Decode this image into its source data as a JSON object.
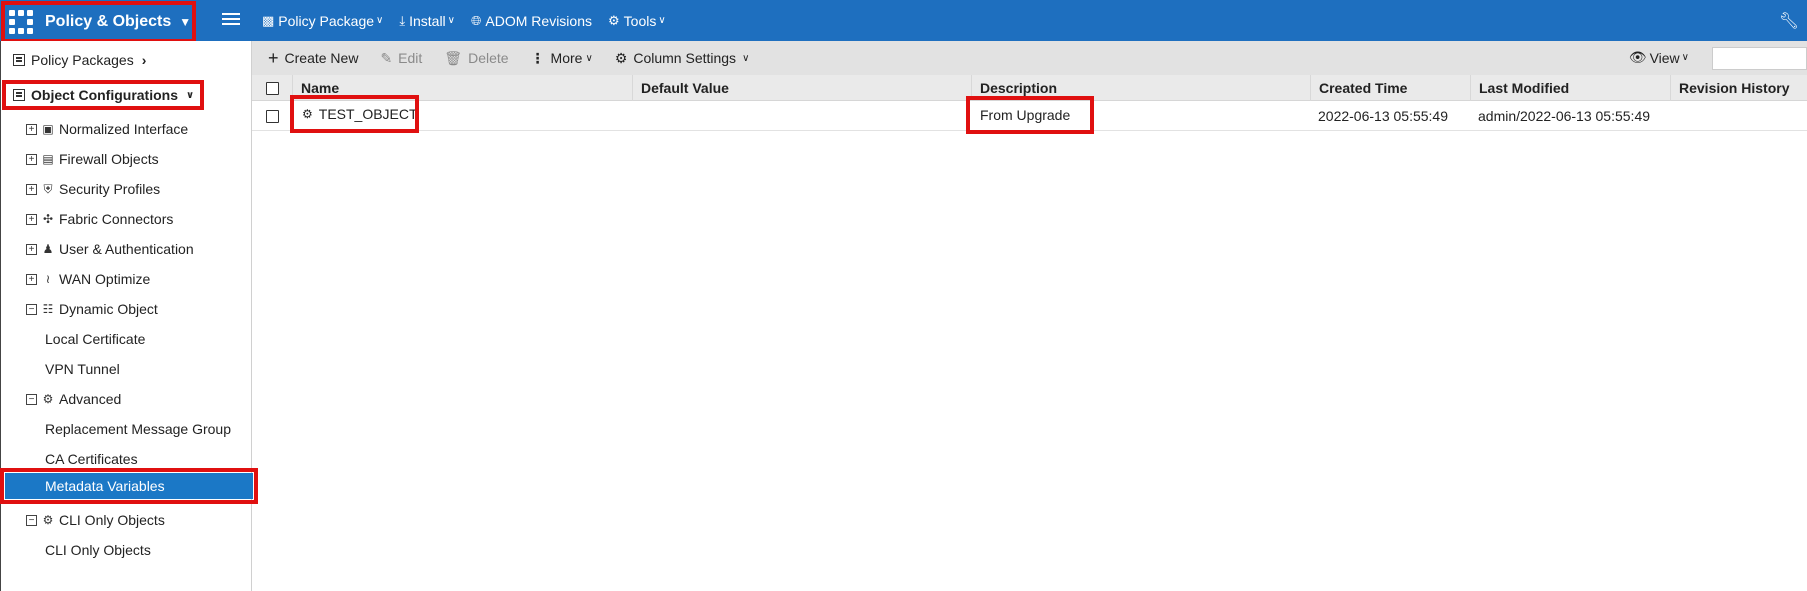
{
  "topbar": {
    "app_title": "Policy & Objects",
    "menu": [
      {
        "label": "Policy Package",
        "icon": "package-icon",
        "dropdown": true
      },
      {
        "label": "Install",
        "icon": "install-icon",
        "dropdown": true
      },
      {
        "label": "ADOM Revisions",
        "icon": "globe-icon",
        "dropdown": false
      },
      {
        "label": "Tools",
        "icon": "gear-icon",
        "dropdown": true
      }
    ]
  },
  "sidebar": {
    "policy_packages": "Policy Packages",
    "object_configurations": "Object Configurations",
    "items": [
      {
        "label": "Normalized Interface",
        "expand": "+",
        "icon": "interface-icon"
      },
      {
        "label": "Firewall Objects",
        "expand": "+",
        "icon": "firewall-icon"
      },
      {
        "label": "Security Profiles",
        "expand": "+",
        "icon": "shield-icon"
      },
      {
        "label": "Fabric Connectors",
        "expand": "+",
        "icon": "connector-icon"
      },
      {
        "label": "User & Authentication",
        "expand": "+",
        "icon": "user-icon"
      },
      {
        "label": "WAN Optimize",
        "expand": "+",
        "icon": "wifi-icon"
      },
      {
        "label": "Dynamic Object",
        "expand": "−",
        "icon": "hierarchy-icon"
      },
      {
        "label": "Local Certificate",
        "leaf": true
      },
      {
        "label": "VPN Tunnel",
        "leaf": true
      },
      {
        "label": "Advanced",
        "expand": "−",
        "icon": "advanced-icon"
      },
      {
        "label": "Replacement Message Group",
        "leaf": true
      },
      {
        "label": "CA Certificates",
        "leaf": true
      },
      {
        "label": "Metadata Variables",
        "leaf": true,
        "selected": true
      },
      {
        "label": "CLI Only Objects",
        "expand": "−",
        "icon": "gear-icon"
      },
      {
        "label": "CLI Only Objects",
        "leaf": true
      }
    ]
  },
  "toolbar": {
    "create_new": "Create New",
    "edit": "Edit",
    "delete": "Delete",
    "more": "More",
    "column_settings": "Column Settings",
    "view": "View"
  },
  "table": {
    "columns": [
      "Name",
      "Default Value",
      "Description",
      "Created Time",
      "Last Modified",
      "Revision History"
    ],
    "rows": [
      {
        "name": "TEST_OBJECT",
        "default_value": "",
        "description": "From Upgrade",
        "created_time": "2022-06-13 05:55:49",
        "last_modified": "admin/2022-06-13 05:55:49",
        "revision_history": ""
      }
    ]
  },
  "colors": {
    "topbar": "#1e6fbf",
    "selected": "#1b78c6",
    "highlight": "#e01010"
  }
}
